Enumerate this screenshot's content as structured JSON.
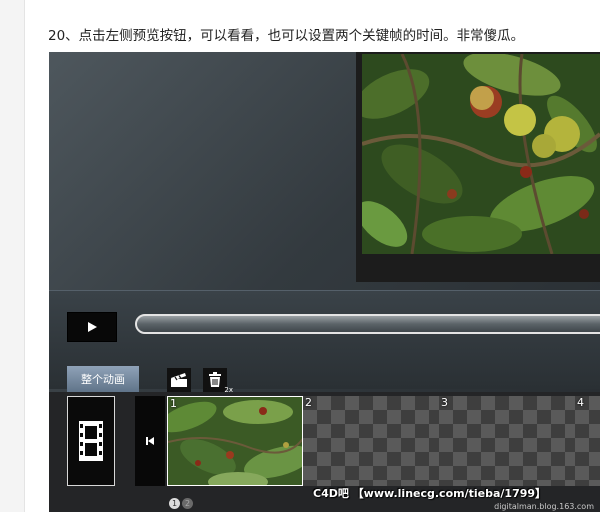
{
  "caption": "20、点击左侧预览按钮，可以看看，也可以设置两个关键帧的时间。非常傻瓜。",
  "player": {
    "play_icon": "play-icon",
    "back_icon": "skip-to-start-icon"
  },
  "timeline": {
    "tab_label": "整个动画",
    "clapper_icon": "clapperboard-icon",
    "trash_icon": "trash-icon",
    "trash_badge": "2x",
    "film_icon": "film-strip-icon",
    "frames": [
      {
        "number": "1"
      },
      {
        "number": "2"
      },
      {
        "number": "3"
      },
      {
        "number": "4"
      }
    ],
    "pages": [
      "1",
      "2"
    ]
  },
  "watermark": "C4D吧 【www.linecg.com/tieba/1799】",
  "small_watermark": "digitalman.blog.163.com"
}
